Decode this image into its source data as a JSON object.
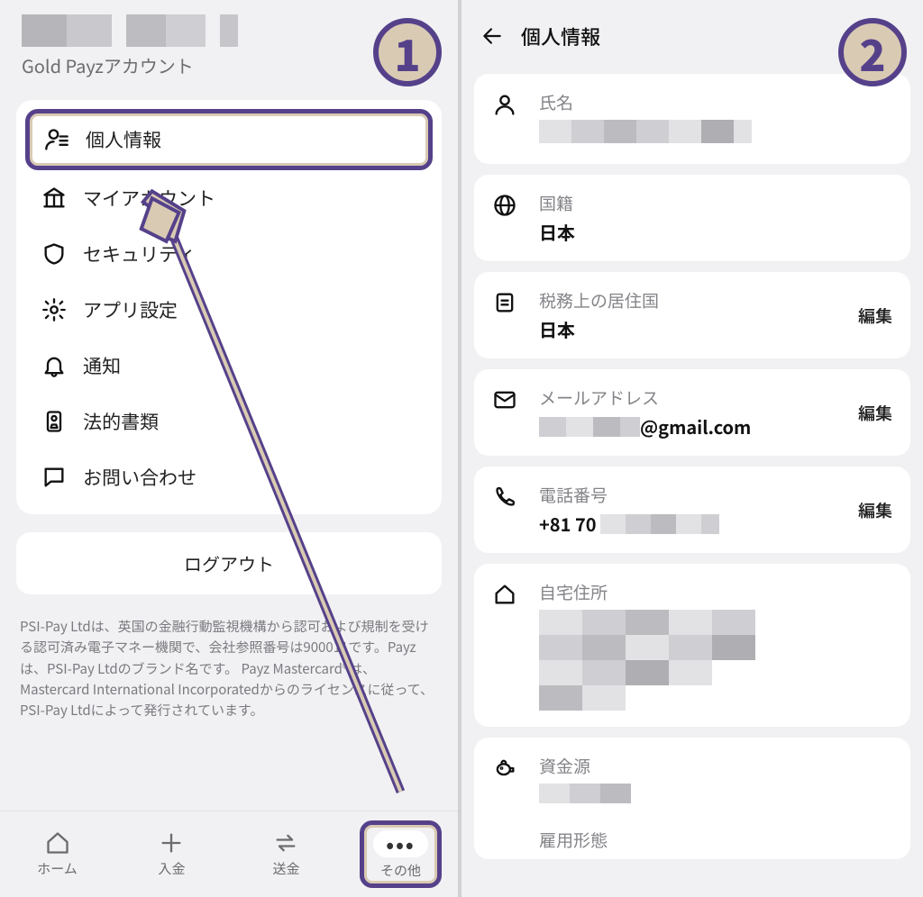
{
  "colors": {
    "accent": "#55418a",
    "badgeBg": "#d9cab3"
  },
  "left": {
    "accountSubtitle": "Gold Payzアカウント",
    "menu": [
      {
        "key": "personal-info",
        "label": "個人情報",
        "icon": "person-list-icon",
        "highlight": true
      },
      {
        "key": "my-account",
        "label": "マイアカウント",
        "icon": "bank-icon"
      },
      {
        "key": "security",
        "label": "セキュリティ",
        "icon": "shield-icon"
      },
      {
        "key": "app-settings",
        "label": "アプリ設定",
        "icon": "gear-icon"
      },
      {
        "key": "notifications",
        "label": "通知",
        "icon": "bell-icon"
      },
      {
        "key": "legal-docs",
        "label": "法的書類",
        "icon": "document-icon"
      },
      {
        "key": "contact",
        "label": "お問い合わせ",
        "icon": "chat-icon"
      }
    ],
    "logout": "ログアウト",
    "legal": "PSI-Pay Ltdは、英国の金融行動監視機構から認可および規制を受ける認可済み電子マネー機関で、会社参照番号は900011です。Payzは、PSI-Pay Ltdのブランド名です。 Payz Mastercard®は、Mastercard International Incorporatedからのライセンスに従って、PSI-Pay Ltdによって発行されています。",
    "nav": {
      "home": "ホーム",
      "deposit": "入金",
      "send": "送金",
      "more": "その他"
    }
  },
  "right": {
    "title": "個人情報",
    "editLabel": "編集",
    "items": {
      "name": {
        "label": "氏名",
        "value": "████████",
        "editable": false
      },
      "nationality": {
        "label": "国籍",
        "value": "日本",
        "editable": false
      },
      "taxCountry": {
        "label": "税務上の居住国",
        "value": "日本",
        "editable": true
      },
      "email": {
        "label": "メールアドレス",
        "value": "████@gmail.com",
        "editable": true
      },
      "phone": {
        "label": "電話番号",
        "value": "+81 70████████",
        "editable": true
      },
      "address": {
        "label": "自宅住所",
        "value": "████████",
        "editable": false
      },
      "funds": {
        "label": "資金源",
        "value": "████",
        "editable": false
      },
      "employment": {
        "label": "雇用形態",
        "value": "",
        "editable": false
      }
    },
    "emailSuffix": "@gmail.com",
    "phonePrefix": "+81 70"
  },
  "badges": {
    "one": "1",
    "two": "2"
  }
}
